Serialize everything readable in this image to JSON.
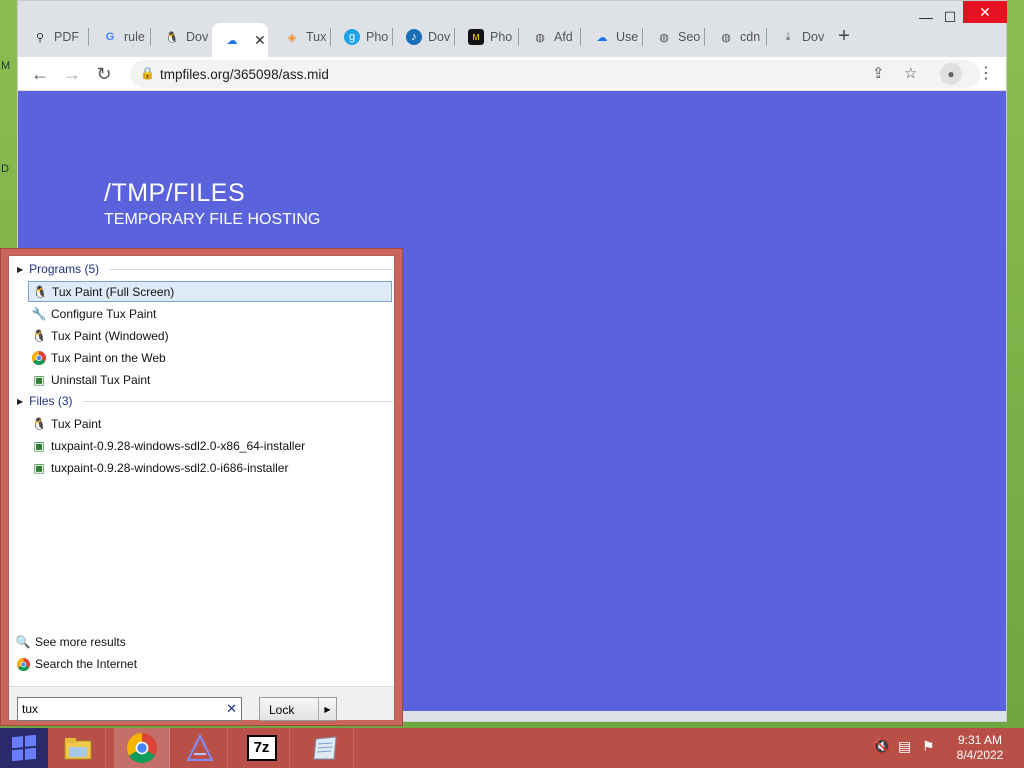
{
  "desktop": {
    "glyph_m": "M",
    "glyph_d": "D"
  },
  "browser": {
    "tabs": [
      {
        "label": "PDF",
        "icon": "app-icon"
      },
      {
        "label": "rule",
        "icon": "google-icon"
      },
      {
        "label": "Dov",
        "icon": "tux-icon"
      },
      {
        "label": "",
        "icon": "upload-cloud-icon"
      },
      {
        "label": "Tux",
        "icon": "diamond-icon"
      },
      {
        "label": "Pho",
        "icon": "g-icon"
      },
      {
        "label": "Dov",
        "icon": "music-icon"
      },
      {
        "label": "Pho",
        "icon": "wave-icon"
      },
      {
        "label": "Afd",
        "icon": "globe-icon"
      },
      {
        "label": "Use",
        "icon": "cloud-icon"
      },
      {
        "label": "Seo",
        "icon": "globe-icon"
      },
      {
        "label": "cdn",
        "icon": "globe-icon"
      },
      {
        "label": "Dov",
        "icon": "download-icon"
      }
    ],
    "url": "tmpfiles.org/365098/ass.mid",
    "page": {
      "title": "/TMP/FILES",
      "subtitle": "TEMPORARY FILE HOSTING"
    }
  },
  "start_menu": {
    "programs_header": "Programs (5)",
    "programs": [
      {
        "label": "Tux Paint (Full Screen)",
        "icon": "tux-icon",
        "selected": true
      },
      {
        "label": "Configure Tux Paint",
        "icon": "wrench-icon"
      },
      {
        "label": "Tux Paint (Windowed)",
        "icon": "tux-icon"
      },
      {
        "label": "Tux Paint on the Web",
        "icon": "chrome-icon"
      },
      {
        "label": "Uninstall Tux Paint",
        "icon": "installer-icon"
      }
    ],
    "files_header": "Files (3)",
    "files": [
      {
        "label": "Tux Paint",
        "icon": "tux-icon"
      },
      {
        "label": "tuxpaint-0.9.28-windows-sdl2.0-x86_64-installer",
        "icon": "installer-icon"
      },
      {
        "label": "tuxpaint-0.9.28-windows-sdl2.0-i686-installer",
        "icon": "installer-icon"
      }
    ],
    "see_more": "See more results",
    "search_internet": "Search the Internet",
    "search_value": "tux",
    "lock_label": "Lock"
  },
  "taskbar": {
    "items": [
      "start-button",
      "file-explorer",
      "chrome",
      "app-a",
      "7zip",
      "notepad"
    ],
    "time": "9:31 AM",
    "date": "8/4/2022"
  }
}
